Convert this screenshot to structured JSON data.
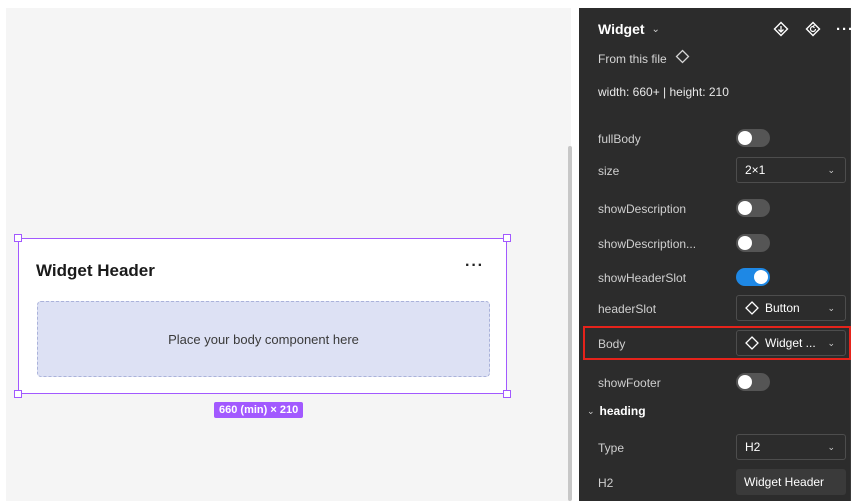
{
  "canvas": {
    "widget": {
      "title": "Widget Header",
      "more_icon": "ellipsis-icon",
      "body_placeholder": "Place your body component here"
    },
    "size_badge": "660 (min) × 210"
  },
  "panel": {
    "title": "Widget",
    "title_chevron": "⌄",
    "header_icons": [
      "component-swap-icon",
      "reset-component-icon",
      "more-icon"
    ],
    "more": "···",
    "source": "From this file",
    "dimensions": "width: 660+ | height: 210",
    "properties": {
      "fullBody": {
        "label": "fullBody",
        "on": false
      },
      "size": {
        "label": "size",
        "value": "2×1"
      },
      "showDescription": {
        "label": "showDescription",
        "on": false
      },
      "showDescription2": {
        "label": "showDescription...",
        "on": false
      },
      "showHeaderSlot": {
        "label": "showHeaderSlot",
        "on": true
      },
      "headerSlot": {
        "label": "headerSlot",
        "value": "Button"
      },
      "body": {
        "label": "Body",
        "value": "Widget ..."
      },
      "showFooter": {
        "label": "showFooter",
        "on": false
      }
    },
    "section": {
      "label": "heading",
      "chevron": "⌄"
    },
    "heading": {
      "type": {
        "label": "Type",
        "value": "H2"
      },
      "h2": {
        "label": "H2",
        "value": "Widget Header"
      }
    },
    "chevron": "⌄"
  },
  "colors": {
    "selection": "#a259ff",
    "panel_bg": "#2c2c2c",
    "toggle_on": "#1e88e5",
    "highlight": "#e5231b",
    "body_fill": "#dde1f4"
  }
}
